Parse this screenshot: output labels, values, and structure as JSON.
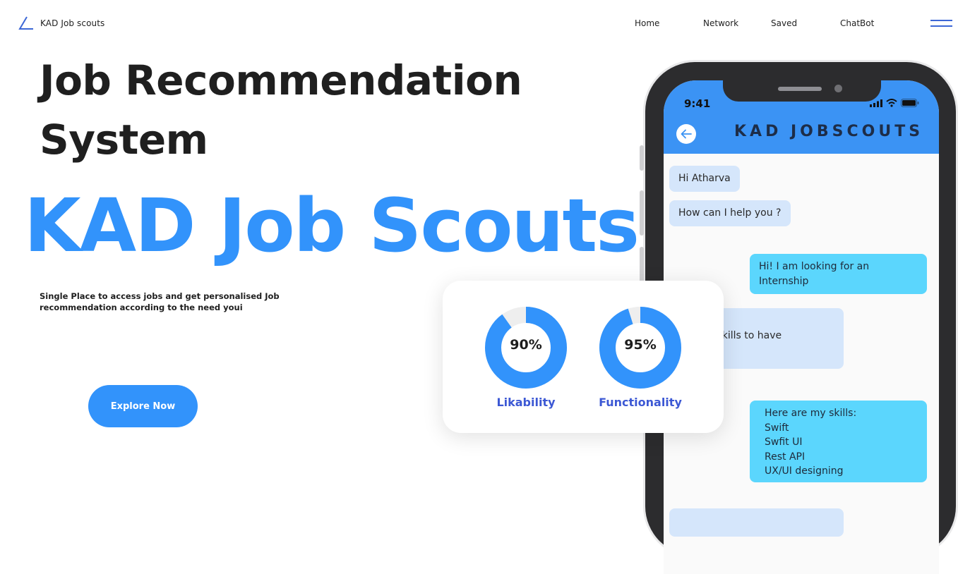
{
  "nav": {
    "brand": "KAD Job scouts",
    "links": [
      "Home",
      "Network",
      "Saved",
      "ChatBot"
    ]
  },
  "hero": {
    "title": "Job Recommendation System",
    "brand_big": "KAD Job Scouts",
    "tagline": "Single Place to access jobs and get personalised Job recommendation according to the need youi",
    "cta": "Explore Now"
  },
  "stats": [
    {
      "value": "90%",
      "label": "Likability",
      "fraction": 0.9
    },
    {
      "value": "95%",
      "label": "Functionality",
      "fraction": 0.95
    }
  ],
  "phone": {
    "time": "9:41",
    "app_title": "KAD JOBSCOUTS",
    "messages": [
      {
        "from": "bot",
        "text": "Hi Atharva"
      },
      {
        "from": "bot",
        "text": "How can I help you ?"
      },
      {
        "from": "user",
        "text": "Hi! I am looking for an Internship"
      },
      {
        "from": "bot",
        "text": "t!\nre your skills to have\nrch."
      },
      {
        "from": "user",
        "text": "Here are my skills:\nSwift\nSwfit UI\nRest API\nUX/UI designing"
      }
    ]
  },
  "colors": {
    "accent": "#3293fb",
    "label_blue": "#3c58d4",
    "user_bubble": "#5bd6fd",
    "bot_bubble": "#d5e6fb",
    "phone_body": "#2c2c2e"
  }
}
